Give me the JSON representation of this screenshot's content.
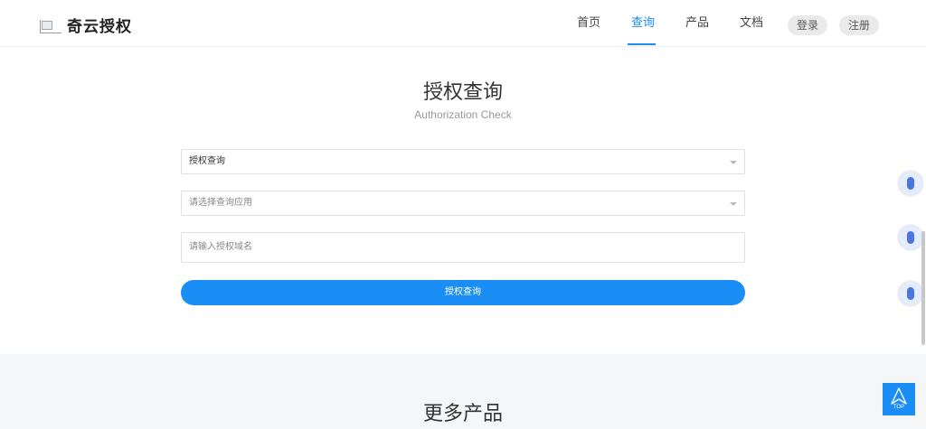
{
  "brand": {
    "name": "奇云授权",
    "logo_icon": "broken-image-icon"
  },
  "nav": {
    "items": [
      {
        "label": "首页",
        "active": false
      },
      {
        "label": "查询",
        "active": true
      },
      {
        "label": "产品",
        "active": false
      },
      {
        "label": "文档",
        "active": false
      }
    ],
    "login_label": "登录",
    "register_label": "注册"
  },
  "page": {
    "title": "授权查询",
    "subtitle": "Authorization Check"
  },
  "form": {
    "type_select": {
      "value": "授权查询"
    },
    "app_select": {
      "placeholder": "请选择查询应用"
    },
    "domain_input": {
      "placeholder": "请输入授权域名"
    },
    "submit_label": "授权查询"
  },
  "section": {
    "more_products_title": "更多产品"
  },
  "floating": {
    "icons": [
      "mouse-icon",
      "mouse-icon",
      "mouse-icon"
    ],
    "top_label": "TOP"
  },
  "colors": {
    "accent": "#1a8ef5",
    "section_bg": "#f5f6f7"
  }
}
